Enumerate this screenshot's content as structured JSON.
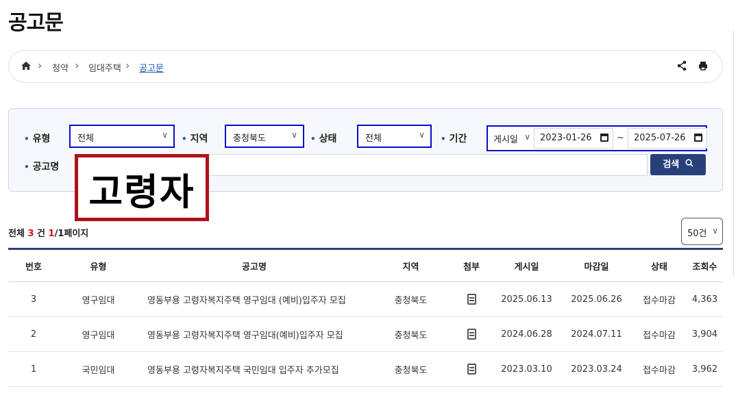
{
  "page": {
    "title": "공고문"
  },
  "breadcrumb": {
    "home_icon": "home-icon",
    "items": [
      "청약",
      "임대주택",
      "공고문"
    ],
    "share_icon": "share-icon",
    "print_icon": "print-icon"
  },
  "filters": {
    "type": {
      "label": "유형",
      "value": "전체"
    },
    "region": {
      "label": "지역",
      "value": "충청북도"
    },
    "status": {
      "label": "상태",
      "value": "전체"
    },
    "period": {
      "label": "기간",
      "basis": "게시일",
      "start": "2023-01-26",
      "separator": "~",
      "end": "2025-07-26"
    },
    "title": {
      "label": "공고명",
      "value": "고령자"
    },
    "search_button": "검색"
  },
  "results": {
    "prefix": "전체",
    "count": "3",
    "unit": "건",
    "page_current": "1",
    "page_total": "/1페이지",
    "per_page": "50건"
  },
  "table": {
    "headers": [
      "번호",
      "유형",
      "공고명",
      "지역",
      "첨부",
      "게시일",
      "마감일",
      "상태",
      "조회수"
    ],
    "rows": [
      {
        "no": "3",
        "type": "영구임대",
        "title": "영동부용 고령자복지주택 영구임대 (예비)입주자 모집",
        "region": "충청북도",
        "attach_icon": "file-icon",
        "posted": "2025.06.13",
        "deadline": "2025.06.26",
        "status": "접수마감",
        "views": "4,363"
      },
      {
        "no": "2",
        "type": "영구임대",
        "title": "영동부용 고령자복지주택 영구임대(예비)입주자 모집",
        "region": "충청북도",
        "attach_icon": "file-icon",
        "posted": "2024.06.28",
        "deadline": "2024.07.11",
        "status": "접수마감",
        "views": "3,904"
      },
      {
        "no": "1",
        "type": "국민임대",
        "title": "영동부용 고령자복지주택 국민임대 입주자 추가모집",
        "region": "충청북도",
        "attach_icon": "file-icon",
        "posted": "2023.03.10",
        "deadline": "2023.03.24",
        "status": "접수마감",
        "views": "3,962"
      }
    ]
  },
  "colors": {
    "accent": "#26407a",
    "highlight_box": "#0a0acc",
    "overlay_border": "#b0101a",
    "count_red": "#d6101a"
  }
}
